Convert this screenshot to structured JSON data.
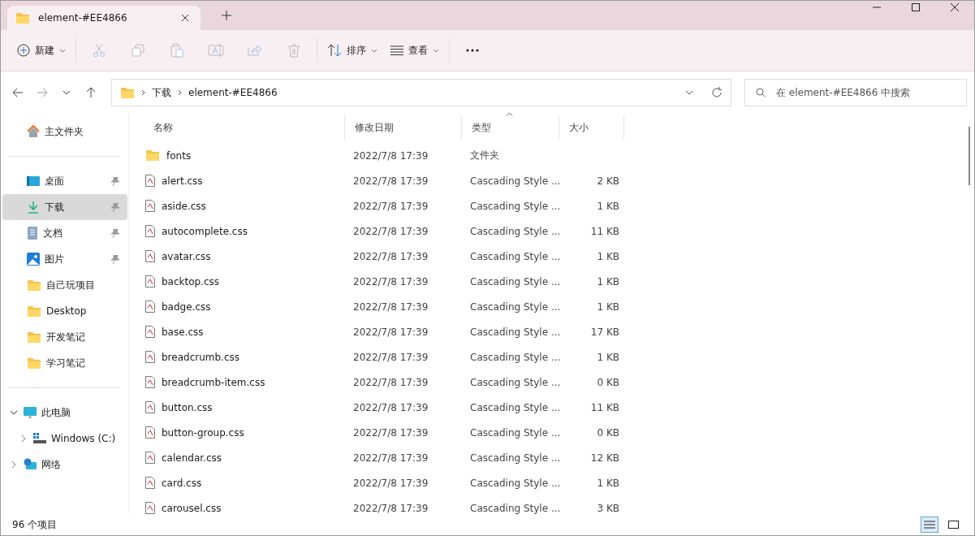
{
  "tab": {
    "title": "element-#EE4866"
  },
  "toolbar": {
    "new_label": "新建",
    "actions": [
      {
        "kind": "cut",
        "disabled": true
      },
      {
        "kind": "copy",
        "disabled": true
      },
      {
        "kind": "paste",
        "disabled": true
      },
      {
        "kind": "rename",
        "disabled": true
      },
      {
        "kind": "share",
        "disabled": true
      },
      {
        "kind": "delete",
        "disabled": true
      }
    ],
    "sort_label": "排序",
    "view_label": "查看"
  },
  "address": {
    "path": [
      "下载",
      "element-#EE4866"
    ]
  },
  "search": {
    "placeholder": "在 element-#EE4866 中搜索"
  },
  "sidebar": {
    "groups": [
      [
        {
          "label": "主文件夹",
          "kind": "home",
          "pinned": false,
          "selected": false
        }
      ],
      [
        {
          "label": "桌面",
          "kind": "desktop",
          "pinned": true,
          "selected": false
        },
        {
          "label": "下载",
          "kind": "download",
          "pinned": true,
          "selected": true
        },
        {
          "label": "文档",
          "kind": "document",
          "pinned": true,
          "selected": false
        },
        {
          "label": "图片",
          "kind": "image",
          "pinned": true,
          "selected": false
        },
        {
          "label": "自己玩项目",
          "kind": "folder",
          "pinned": false,
          "selected": false
        },
        {
          "label": "Desktop",
          "kind": "folder",
          "pinned": false,
          "selected": false
        },
        {
          "label": "开发笔记",
          "kind": "folder",
          "pinned": false,
          "selected": false
        },
        {
          "label": "学习笔记",
          "kind": "folder",
          "pinned": false,
          "selected": false
        }
      ]
    ],
    "tree": [
      {
        "label": "此电脑",
        "kind": "computer",
        "expanded": true,
        "children": [
          {
            "label": "Windows (C:)",
            "kind": "drive",
            "expanded": false
          }
        ]
      },
      {
        "label": "网络",
        "kind": "network",
        "expanded": false
      }
    ]
  },
  "table": {
    "columns": [
      {
        "label": "名称",
        "sorted": false
      },
      {
        "label": "修改日期",
        "sorted": false
      },
      {
        "label": "类型",
        "sorted": true
      },
      {
        "label": "大小",
        "sorted": false
      }
    ],
    "rows": [
      {
        "kind": "folder",
        "name": "fonts",
        "date": "2022/7/8 17:39",
        "type": "文件夹",
        "size": ""
      },
      {
        "kind": "file",
        "name": "alert.css",
        "date": "2022/7/8 17:39",
        "type": "Cascading Style ...",
        "size": "2 KB"
      },
      {
        "kind": "file",
        "name": "aside.css",
        "date": "2022/7/8 17:39",
        "type": "Cascading Style ...",
        "size": "1 KB"
      },
      {
        "kind": "file",
        "name": "autocomplete.css",
        "date": "2022/7/8 17:39",
        "type": "Cascading Style ...",
        "size": "11 KB"
      },
      {
        "kind": "file",
        "name": "avatar.css",
        "date": "2022/7/8 17:39",
        "type": "Cascading Style ...",
        "size": "1 KB"
      },
      {
        "kind": "file",
        "name": "backtop.css",
        "date": "2022/7/8 17:39",
        "type": "Cascading Style ...",
        "size": "1 KB"
      },
      {
        "kind": "file",
        "name": "badge.css",
        "date": "2022/7/8 17:39",
        "type": "Cascading Style ...",
        "size": "1 KB"
      },
      {
        "kind": "file",
        "name": "base.css",
        "date": "2022/7/8 17:39",
        "type": "Cascading Style ...",
        "size": "17 KB"
      },
      {
        "kind": "file",
        "name": "breadcrumb.css",
        "date": "2022/7/8 17:39",
        "type": "Cascading Style ...",
        "size": "1 KB"
      },
      {
        "kind": "file",
        "name": "breadcrumb-item.css",
        "date": "2022/7/8 17:39",
        "type": "Cascading Style ...",
        "size": "0 KB"
      },
      {
        "kind": "file",
        "name": "button.css",
        "date": "2022/7/8 17:39",
        "type": "Cascading Style ...",
        "size": "11 KB"
      },
      {
        "kind": "file",
        "name": "button-group.css",
        "date": "2022/7/8 17:39",
        "type": "Cascading Style ...",
        "size": "0 KB"
      },
      {
        "kind": "file",
        "name": "calendar.css",
        "date": "2022/7/8 17:39",
        "type": "Cascading Style ...",
        "size": "12 KB"
      },
      {
        "kind": "file",
        "name": "card.css",
        "date": "2022/7/8 17:39",
        "type": "Cascading Style ...",
        "size": "1 KB"
      },
      {
        "kind": "file",
        "name": "carousel.css",
        "date": "2022/7/8 17:39",
        "type": "Cascading Style ...",
        "size": "3 KB"
      }
    ]
  },
  "status_bar": {
    "count": "96 个项目",
    "view_buttons": [
      {
        "kind": "details",
        "selected": true
      },
      {
        "kind": "tiles",
        "selected": false
      }
    ]
  }
}
